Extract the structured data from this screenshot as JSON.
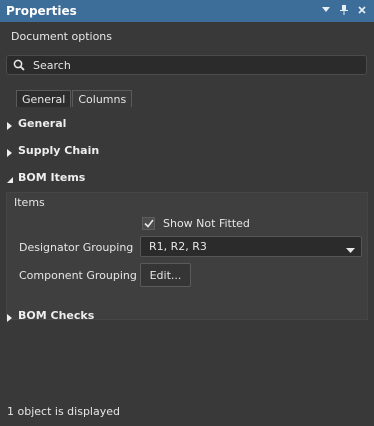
{
  "title_bar": {
    "title": "Properties",
    "icons": [
      "menu-arrow-icon",
      "pin-icon",
      "close-icon"
    ]
  },
  "panel": {
    "heading": "Document options",
    "search": {
      "placeholder": "Search",
      "value": ""
    },
    "tabs": [
      {
        "label": "General",
        "active": true
      },
      {
        "label": "Columns",
        "active": false
      }
    ],
    "sections": {
      "general": {
        "label": "General",
        "expanded": false
      },
      "supply_chain": {
        "label": "Supply Chain",
        "expanded": false
      },
      "bom_items": {
        "label": "BOM Items",
        "expanded": true,
        "items_label": "Items",
        "show_not_fitted": {
          "label": "Show Not Fitted",
          "checked": true
        },
        "designator_grouping": {
          "label": "Designator Grouping",
          "value": "R1, R2, R3"
        },
        "component_grouping": {
          "label": "Component Grouping",
          "button_label": "Edit..."
        }
      },
      "bom_checks": {
        "label": "BOM Checks",
        "expanded": false
      }
    },
    "status": "1 object is displayed"
  },
  "colors": {
    "title_bar": "#3d6e99",
    "panel_bg": "#393939",
    "text": "#e6e6e6"
  }
}
